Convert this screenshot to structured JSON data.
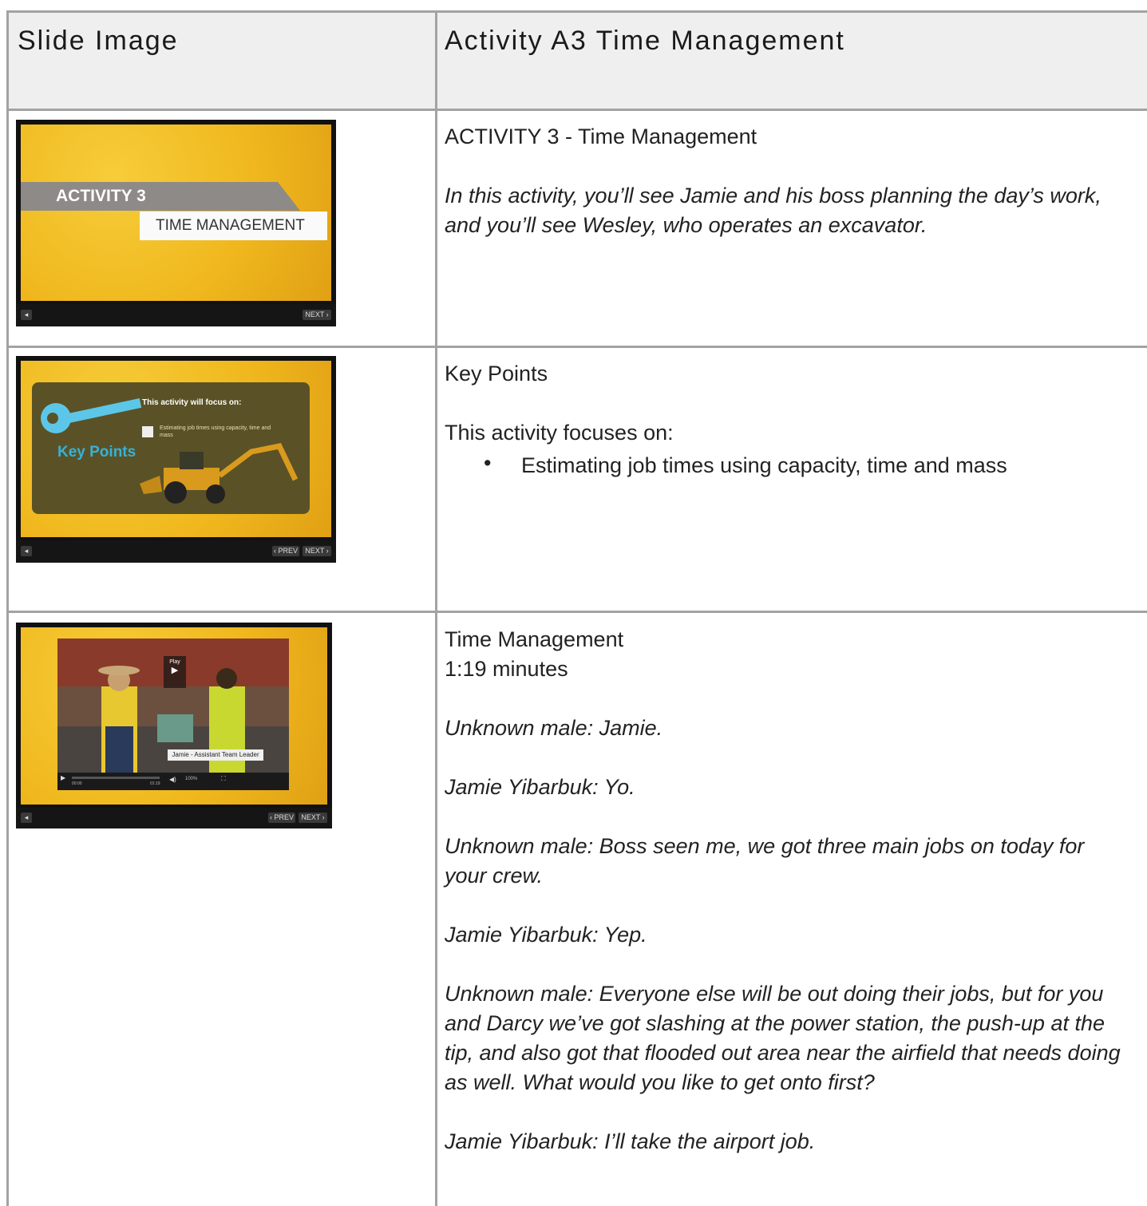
{
  "header": {
    "col1": "Slide Image",
    "col2": "Activity A3 Time Management"
  },
  "rows": {
    "row1": {
      "title": "ACTIVITY 3 - Time Management",
      "body": "In this activity, you’ll see Jamie and his boss planning the day’s work, and you’ll see Wesley, who operates an excavator.",
      "slide": {
        "band_top": "ACTIVITY 3",
        "band_bottom": "TIME MANAGEMENT",
        "next": "NEXT ›"
      }
    },
    "row2": {
      "title": "Key Points",
      "intro": "This activity focuses on:",
      "bullet_char": "•",
      "bullet": "Estimating job times using capacity, time and mass",
      "slide": {
        "key_label": "Key Points",
        "focus": "This activity will focus on:",
        "item": "Estimating job times using capacity, time and mass",
        "prev": "‹ PREV",
        "next": "NEXT ›"
      }
    },
    "row3": {
      "title": "Time Management",
      "duration": "1:19 minutes",
      "lines": [
        "Unknown male: Jamie.",
        "Jamie Yibarbuk: Yo.",
        "Unknown male: Boss seen me, we got three main jobs on today for your crew.",
        "Jamie Yibarbuk: Yep.",
        "Unknown male: Everyone else will be out doing their jobs, but for you and Darcy we’ve got slashing at the power station, the push-up at the tip, and also got that flooded out area near the airfield that needs doing as well. What would you like to get onto first?",
        "Jamie Yibarbuk: I’ll take the airport job."
      ],
      "slide": {
        "play": "Play",
        "caption": "Jamie - Assistant Team Leader",
        "time_start": "00:00",
        "time_end": "01:19",
        "zoom": "100%",
        "prev": "‹ PREV",
        "next": "NEXT ›"
      }
    }
  }
}
